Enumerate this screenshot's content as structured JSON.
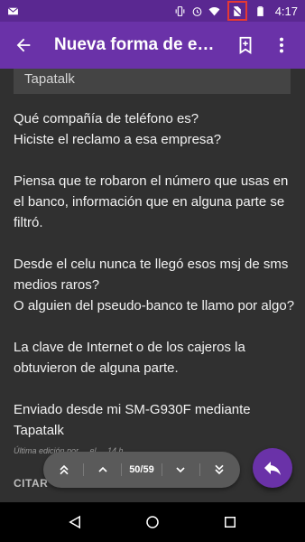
{
  "status_bar": {
    "time": "4:17",
    "icons": [
      "gmail-icon",
      "vibrate-icon",
      "alarm-icon",
      "wifi-icon",
      "no-sim-icon",
      "battery-icon"
    ],
    "highlight_color": "#e53935"
  },
  "app_bar": {
    "title": "Nueva forma de e…",
    "icons": [
      "back-arrow-icon",
      "bookmark-icon",
      "more-vert-icon"
    ]
  },
  "post": {
    "quote_text": "Tapatalk",
    "paragraphs": [
      [
        "Qué compañía de teléfono es?",
        "Hiciste el reclamo a esa empresa?"
      ],
      [
        "Piensa que te robaron el número que usas en el banco, información que en alguna parte se filtró."
      ],
      [
        "Desde el celu nunca te llegó esos msj de sms medios raros?",
        "O alguien del pseudo-banco te llamo por algo?"
      ],
      [
        "La clave de Internet o de los cajeros la obtuvieron de alguna parte."
      ],
      [
        "Enviado desde mi SM-G930F mediante Tapatalk"
      ]
    ],
    "edit_note": "Última edición por ... el ... 14 h.",
    "quote_button": "CITAR"
  },
  "pager": {
    "page_indicator": "50/59",
    "icons": [
      "double-chevron-up-icon",
      "chevron-up-icon",
      "chevron-down-icon",
      "double-chevron-down-icon"
    ]
  },
  "fab": {
    "icon": "reply-icon"
  },
  "nav_bar": {
    "icons": [
      "back-triangle-icon",
      "home-circle-icon",
      "recents-square-icon"
    ]
  },
  "colors": {
    "status_bar": "#5a2891",
    "app_bar": "#6a32a8",
    "background": "#303030",
    "quote_box": "#444444",
    "pager": "#5a5a5a",
    "accent": "#6a32a8"
  }
}
